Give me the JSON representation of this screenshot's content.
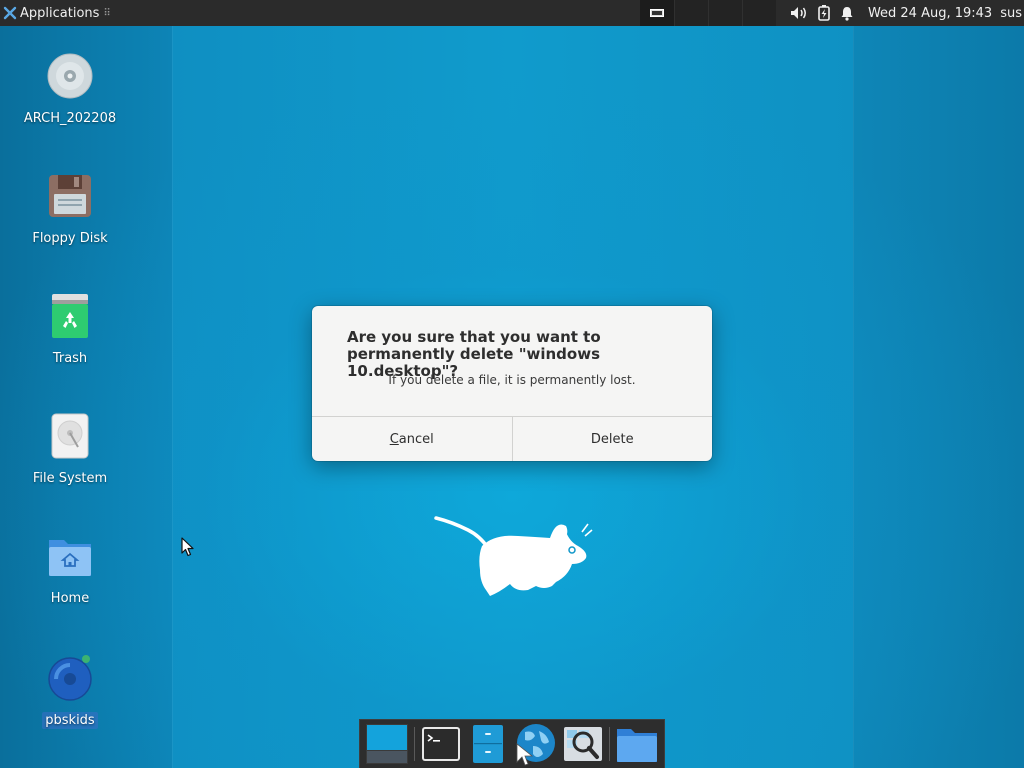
{
  "panel": {
    "applications_label": "Applications",
    "grip": "⠿",
    "clock": "Wed 24 Aug, 19:43",
    "user": "sus"
  },
  "desktop_icons": [
    {
      "label": "ARCH_202208",
      "icon": "cd-disc-icon"
    },
    {
      "label": "Floppy Disk",
      "icon": "floppy-disk-icon"
    },
    {
      "label": "Trash",
      "icon": "trash-icon"
    },
    {
      "label": "File System",
      "icon": "hard-drive-icon"
    },
    {
      "label": "Home",
      "icon": "home-folder-icon"
    },
    {
      "label": "pbskids",
      "icon": "pbskids-icon"
    }
  ],
  "dialog": {
    "title": "Are you sure that you want to permanently delete \"windows 10.desktop\"?",
    "body": "If you delete a file, it is permanently lost.",
    "cancel_first": "C",
    "cancel_rest": "ancel",
    "delete_label": "Delete"
  },
  "dock": {
    "items": [
      "show-desktop-icon",
      "terminal-icon",
      "file-manager-icon",
      "web-browser-icon",
      "app-finder-icon",
      "folder-icon"
    ]
  },
  "colors": {
    "desktop_bg": "#109bcc",
    "panel_bg": "#2b2b2b",
    "dialog_bg": "#f5f5f4"
  }
}
